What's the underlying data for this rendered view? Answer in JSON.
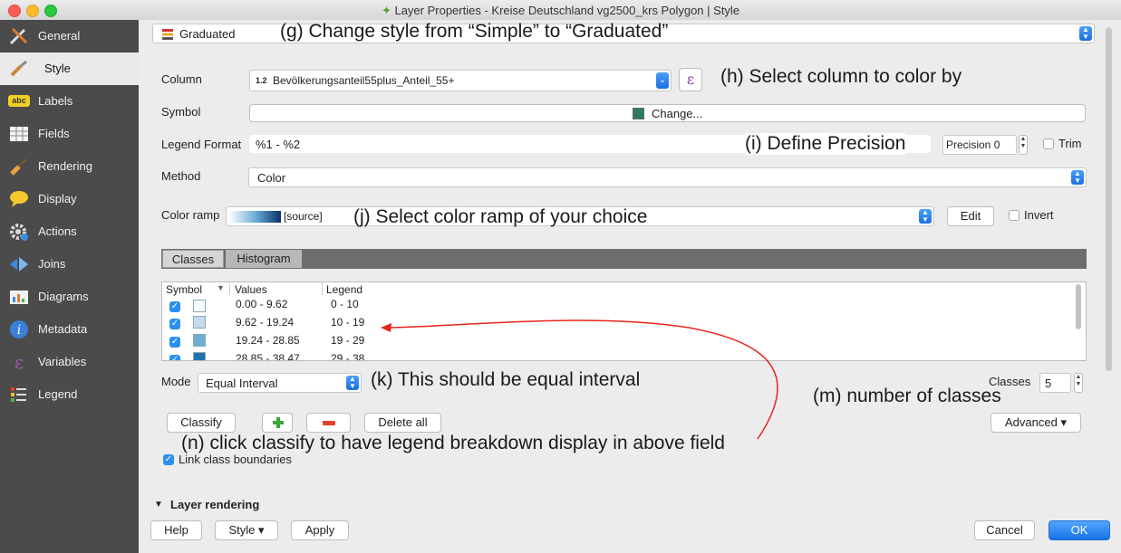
{
  "window": {
    "title": "Layer Properties - Kreise Deutschland vg2500_krs Polygon | Style"
  },
  "sidebar": {
    "items": [
      {
        "label": "General",
        "icon": "tools-icon"
      },
      {
        "label": "Style",
        "icon": "paintbrush-icon"
      },
      {
        "label": "Labels",
        "icon": "abc-label-icon"
      },
      {
        "label": "Fields",
        "icon": "table-icon"
      },
      {
        "label": "Rendering",
        "icon": "paint-brush-icon"
      },
      {
        "label": "Display",
        "icon": "speech-bubble-icon"
      },
      {
        "label": "Actions",
        "icon": "gear-icon"
      },
      {
        "label": "Joins",
        "icon": "join-icon"
      },
      {
        "label": "Diagrams",
        "icon": "diagram-icon"
      },
      {
        "label": "Metadata",
        "icon": "info-icon"
      },
      {
        "label": "Variables",
        "icon": "epsilon-icon"
      },
      {
        "label": "Legend",
        "icon": "legend-icon"
      }
    ],
    "active": "Style"
  },
  "style": {
    "renderer_value": "Graduated",
    "column_label": "Column",
    "column_type": "1.2",
    "column_value": "Bevölkerungsanteil55plus_Anteil_55+",
    "symbol_label": "Symbol",
    "symbol_button": "Change...",
    "symbol_color": "#2a7a66",
    "legend_format_label": "Legend Format",
    "legend_format_value": "%1 - %2",
    "precision_value": "Precision 0",
    "trim_label": "Trim",
    "method_label": "Method",
    "method_value": "Color",
    "color_ramp_label": "Color ramp",
    "color_ramp_value": "[source]",
    "edit_button": "Edit",
    "invert_label": "Invert"
  },
  "tabs": [
    {
      "label": "Classes",
      "active": true
    },
    {
      "label": "Histogram",
      "active": false
    }
  ],
  "classes_table": {
    "headers": [
      "Symbol",
      "Values",
      "Legend"
    ],
    "rows": [
      {
        "values": "0.00 - 9.62",
        "legend": "0 - 10",
        "color": "#f7fbff"
      },
      {
        "values": "9.62 - 19.24",
        "legend": "10 - 19",
        "color": "#c6dbef"
      },
      {
        "values": "19.24 - 28.85",
        "legend": "19 - 29",
        "color": "#6baed6"
      },
      {
        "values": "28.85 - 38.47",
        "legend": "29 - 38",
        "color": "#2171b5"
      }
    ]
  },
  "mode": {
    "label": "Mode",
    "value": "Equal Interval",
    "classes_label": "Classes",
    "classes_value": "5"
  },
  "buttons": {
    "classify": "Classify",
    "add_icon": "plus-icon",
    "remove_icon": "minus-icon",
    "delete_all": "Delete all",
    "advanced": "Advanced ▾",
    "link_boundaries": "Link class boundaries",
    "layer_rendering": "Layer rendering",
    "help": "Help",
    "style": "Style ▾",
    "apply": "Apply",
    "cancel": "Cancel",
    "ok": "OK"
  },
  "annotations": {
    "g": "(g) Change style from “Simple” to “Graduated”",
    "h": "(h) Select column to color by",
    "i": "(i) Define Precision",
    "j": "(j) Select color ramp of your choice",
    "k": "(k) This should be equal interval",
    "m": "(m) number of classes",
    "n": "(n) click classify to have legend breakdown display in above field"
  },
  "colors": {
    "accent": "#1a7ef5",
    "sidebar_bg": "#4b4b4b",
    "arrow": "#e8241a"
  }
}
